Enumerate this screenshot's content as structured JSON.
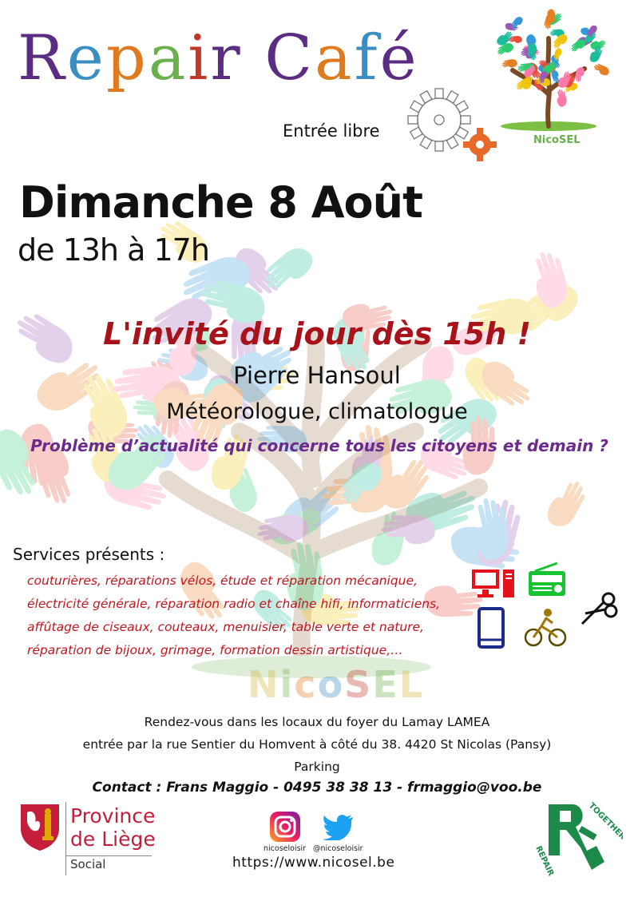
{
  "title": {
    "letters": [
      "R",
      "e",
      "p",
      "a",
      "i",
      "r",
      " ",
      "C",
      "a",
      "f",
      "é"
    ],
    "colors": [
      "#5a2d82",
      "#3a8ec2",
      "#e07a1f",
      "#6ab04c",
      "#c0392b",
      "#5a2d82",
      "#ffffff",
      "#5a2d82",
      "#e07a1f",
      "#3a8ec2",
      "#5a2d82"
    ]
  },
  "entree_libre": "Entrée libre",
  "event": {
    "date": "Dimanche 8 Août",
    "hours": "de 13h à 17h"
  },
  "guest": {
    "headline": "L'invité du jour dès 15h !",
    "name": "Pierre Hansoul",
    "role": "Météorologue, climatologue",
    "question": "Problème d’actualité qui concerne tous les citoyens et demain ?"
  },
  "services": {
    "title": "Services présents :",
    "lines": [
      "couturières, réparations vélos, étude et réparation mécanique,",
      "électricité générale, réparation radio et chaîne hifi, informaticiens,",
      "affûtage de ciseaux, couteaux, menuisier, table verte et nature,",
      "réparation de bijoux, grimage, formation dessin artistique,…"
    ]
  },
  "watermark": {
    "letters": [
      "N",
      "i",
      "c",
      "o",
      "S",
      "E",
      "L"
    ],
    "colors": [
      "#d4b63a",
      "#6ab04c",
      "#e07a1f",
      "#3a8ec2",
      "#c0392b",
      "#6ab04c",
      "#d4b63a"
    ]
  },
  "logo_nicosel": "NicoSEL",
  "address": {
    "line1": "Rendez-vous dans les locaux du foyer du Lamay LAMEA",
    "line2": "entrée par la rue Sentier du Homvent à côté du 38. 4420 St Nicolas (Pansy)",
    "line3": "Parking"
  },
  "contact": "Contact : Frans Maggio -  0495 38 38 13 - frmaggio@voo.be",
  "social": {
    "instagram": "nicoseloisir",
    "twitter": "@nicoseloisir",
    "url": "https://www.nicosel.be"
  },
  "province": {
    "line1": "Province",
    "line2": "de Liège",
    "sub": "Social"
  },
  "together_repair": {
    "top": "TOGETHER",
    "bottom": "REPAIR"
  },
  "icons": [
    "gear-icon",
    "computer-icon",
    "radio-icon",
    "phone-icon",
    "bicycle-icon",
    "scissors-icon"
  ]
}
